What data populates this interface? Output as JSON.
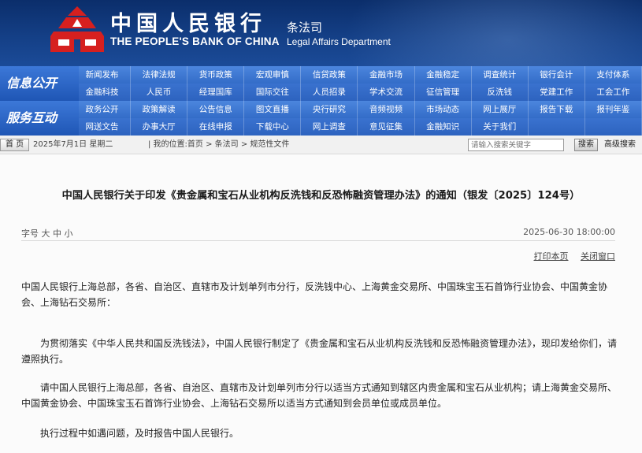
{
  "header": {
    "bank_name_cn": "中国人民银行",
    "bank_name_en": "THE PEOPLE'S BANK OF CHINA",
    "dept_cn": "条法司",
    "dept_en": "Legal Affairs Department"
  },
  "colors": {
    "banner": "#143f86",
    "nav": "#2a62c0",
    "logo_red": "#d6201f"
  },
  "nav": {
    "band1_label": "信息公开",
    "band2_label": "服务互动",
    "rows": [
      [
        "新闻发布",
        "法律法规",
        "货币政策",
        "宏观审慎",
        "信贷政策",
        "金融市场",
        "金融稳定",
        "调查统计",
        "银行会计",
        "支付体系"
      ],
      [
        "金融科技",
        "人民币",
        "经理国库",
        "国际交往",
        "人员招录",
        "学术交流",
        "征信管理",
        "反洗钱",
        "党建工作",
        "工会工作"
      ],
      [
        "政务公开",
        "政策解读",
        "公告信息",
        "图文直播",
        "央行研究",
        "音频视频",
        "市场动态",
        "网上展厅",
        "报告下载",
        "报刊年鉴"
      ],
      [
        "网送文告",
        "办事大厅",
        "在线申报",
        "下载中心",
        "网上调查",
        "意见征集",
        "金融知识",
        "关于我们",
        "",
        ""
      ]
    ]
  },
  "toolbar": {
    "home_label": "首 页",
    "date_text": "2025年7月1日 星期二",
    "breadcrumb": "| 我的位置:首页 > 条法司 > 规范性文件",
    "search_placeholder": "请输入搜索关键字",
    "search_button": "搜索",
    "advanced_search": "高级搜索"
  },
  "article": {
    "title": "中国人民银行关于印发《贵金属和宝石从业机构反洗钱和反恐怖融资管理办法》的通知（银发〔2025〕124号）",
    "font_size_label": "字号",
    "font_size_options": [
      "大",
      "中",
      "小"
    ],
    "publish_time": "2025-06-30 18:00:00",
    "print_label": "打印本页",
    "close_label": "关闭窗口",
    "paragraphs": [
      "中国人民银行上海总部，各省、自治区、直辖市及计划单列市分行，反洗钱中心、上海黄金交易所、中国珠宝玉石首饰行业协会、中国黄金协会、上海钻石交易所：",
      "为贯彻落实《中华人民共和国反洗钱法》，中国人民银行制定了《贵金属和宝石从业机构反洗钱和反恐怖融资管理办法》，现印发给你们，请遵照执行。",
      "请中国人民银行上海总部，各省、自治区、直辖市及计划单列市分行以适当方式通知到辖区内贵金属和宝石从业机构；请上海黄金交易所、中国黄金协会、中国珠宝玉石首饰行业协会、上海钻石交易所以适当方式通知到会员单位或成员单位。",
      "执行过程中如遇问题，及时报告中国人民银行。"
    ]
  }
}
